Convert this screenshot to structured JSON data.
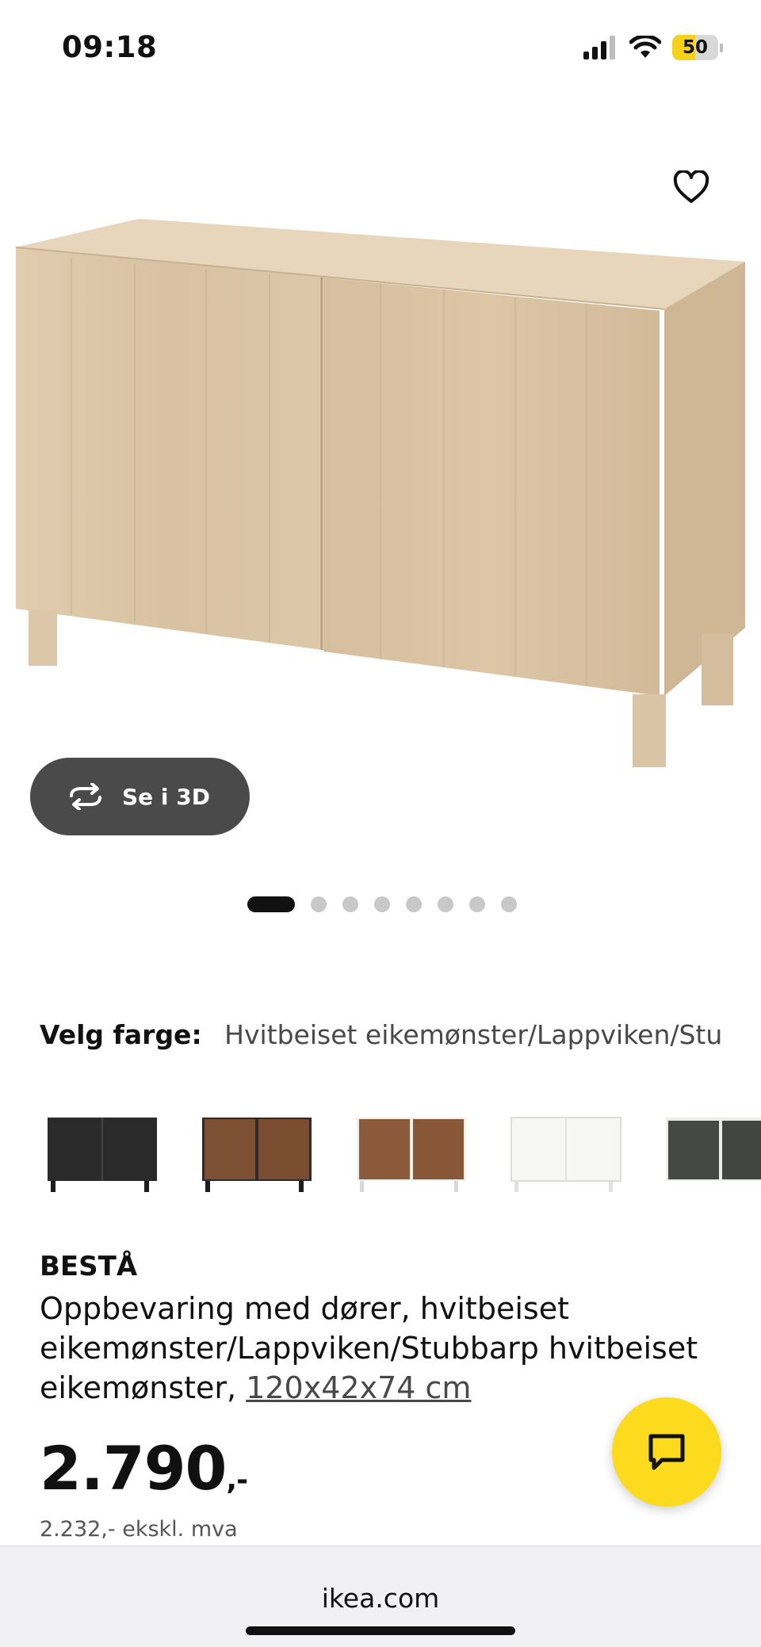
{
  "status_bar": {
    "time": "09:18",
    "battery_percent": 50,
    "battery_label": "50",
    "icons": [
      "cellular-signal-icon",
      "wifi-icon",
      "battery-icon"
    ]
  },
  "product_image": {
    "carousel_pages": 8,
    "active_page": 1
  },
  "view_3d": {
    "label": "Se i 3D"
  },
  "color_select": {
    "label": "Velg farge:",
    "value": "Hvitbeiset eikemønster/Lappviken/Stu..."
  },
  "product": {
    "name": "BESTÅ",
    "description": "Oppbevaring med dører, hvitbeiset eikemønster/Lappviken/Stubbarp hvitbeiset eikemønster,",
    "size": "120x42x74 cm",
    "price": "2.790",
    "price_suffix": ",-",
    "price_ex_vat": "2.232,- ekskl. mva"
  },
  "browser": {
    "url": "ikea.com"
  },
  "colors": {
    "accent_yellow": "#fcdb1e",
    "dark_button": "#4a4a4a"
  }
}
